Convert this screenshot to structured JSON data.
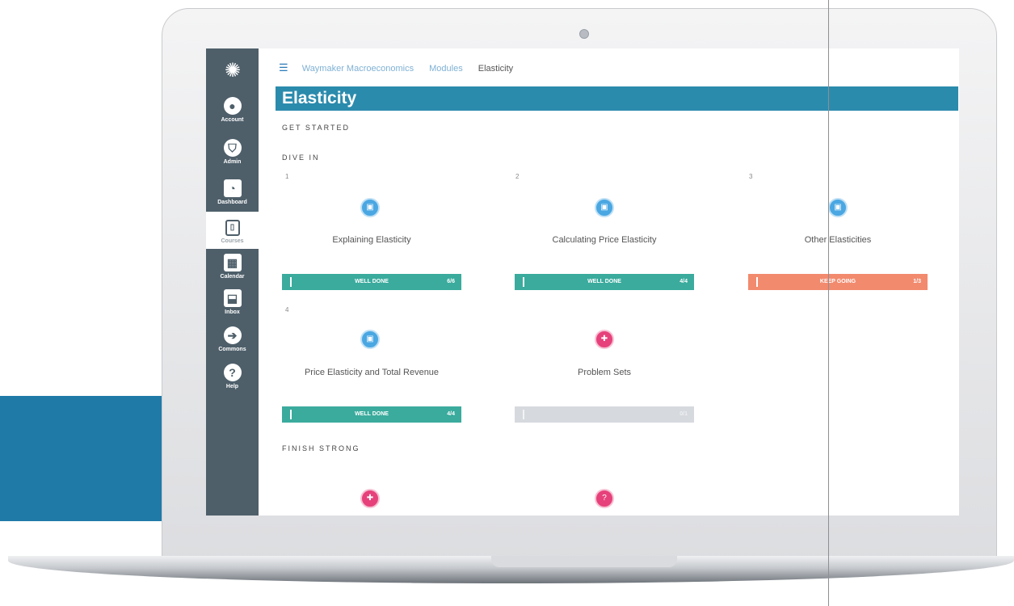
{
  "app": {
    "breadcrumb": [
      "Waymaker Macroeconomics",
      "Modules",
      "Elasticity"
    ],
    "page_title": "Elasticity"
  },
  "nav": {
    "items": [
      {
        "label": "Account",
        "icon": "user-icon"
      },
      {
        "label": "Admin",
        "icon": "shield-icon"
      },
      {
        "label": "Dashboard",
        "icon": "gauge-icon"
      },
      {
        "label": "Courses",
        "icon": "book-icon"
      },
      {
        "label": "Calendar",
        "icon": "calendar-icon"
      },
      {
        "label": "Inbox",
        "icon": "inbox-icon"
      },
      {
        "label": "Commons",
        "icon": "commons-icon"
      },
      {
        "label": "Help",
        "icon": "help-icon"
      }
    ]
  },
  "sections": {
    "get_started": "GET STARTED",
    "dive_in": "DIVE IN",
    "finish_strong": "FINISH STRONG"
  },
  "modules": [
    {
      "number": "1",
      "title": "Explaining Elasticity",
      "status": "WELL DONE",
      "count": "6/6",
      "color": "#3aab9d"
    },
    {
      "number": "2",
      "title": "Calculating Price Elasticity",
      "status": "WELL DONE",
      "count": "4/4",
      "color": "#3aab9d"
    },
    {
      "number": "3",
      "title": "Other Elasticities",
      "status": "KEEP GOING",
      "count": "1/3",
      "color": "#f28a6e"
    },
    {
      "number": "4",
      "title": "Price Elasticity and Total Revenue",
      "status": "WELL DONE",
      "count": "4/4",
      "color": "#3aab9d"
    },
    {
      "number": "",
      "title": "Problem Sets",
      "status": "",
      "count": "0/1",
      "color": "#d6d9de"
    }
  ]
}
